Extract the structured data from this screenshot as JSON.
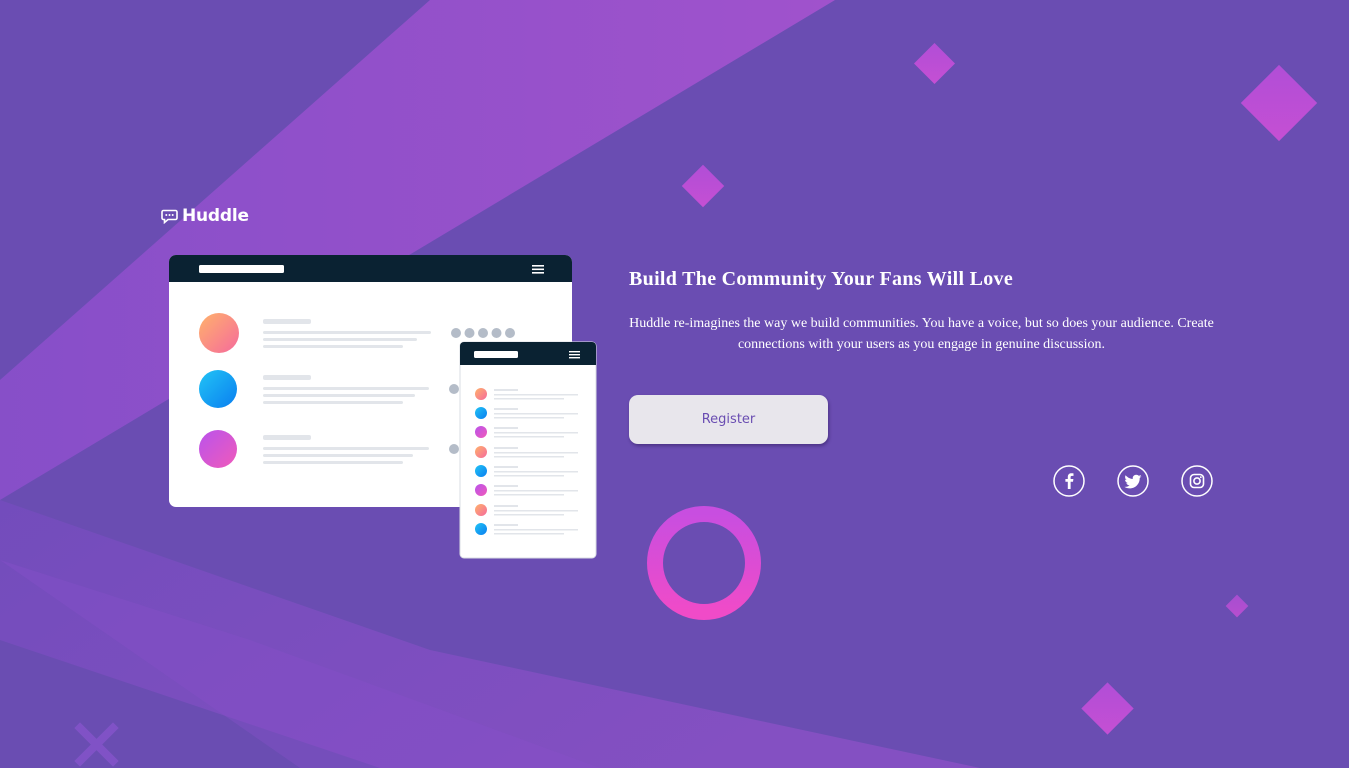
{
  "brand": {
    "name": "Huddle",
    "logo_icon": "chat-bubble-icon"
  },
  "hero": {
    "headline": "Build The Community Your Fans Will Love",
    "description": "Huddle re-imagines the way we build communities. You have a voice, but so does your audience. Create connections with your users as you engage in genuine discussion.",
    "register_label": "Register"
  },
  "socials": [
    {
      "icon": "facebook-icon"
    },
    {
      "icon": "twitter-icon"
    },
    {
      "icon": "instagram-icon"
    }
  ],
  "colors": {
    "background": "#6a4db2",
    "accent_pink": "#e84cd6",
    "button_bg": "#e8e6ec",
    "button_text": "#6a4db2",
    "mockup_header": "#0a2232",
    "white": "#ffffff"
  }
}
